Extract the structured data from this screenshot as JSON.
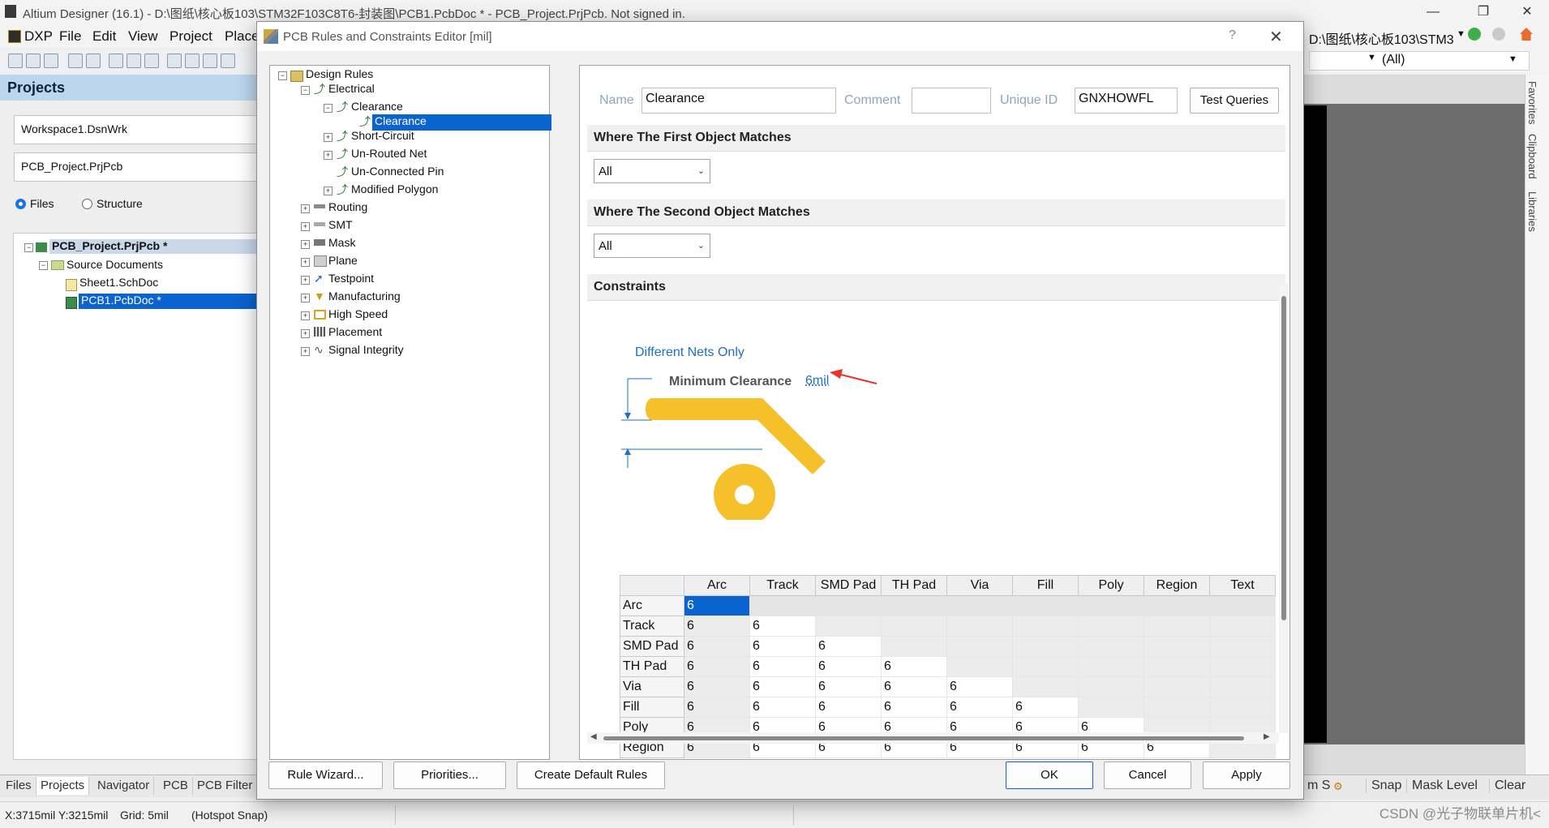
{
  "app": {
    "title": "Altium Designer (16.1) - D:\\图纸\\核心板103\\STM32F103C8T6-封装图\\PCB1.PcbDoc * - PCB_Project.PrjPcb. Not signed in.",
    "menu": [
      "DXP",
      "File",
      "Edit",
      "View",
      "Project",
      "Place"
    ],
    "right_path": "D:\\图纸\\核心板103\\STM3",
    "right_filter": "(All)"
  },
  "projects": {
    "header": "Projects",
    "workspace": "Workspace1.DsnWrk",
    "project": "PCB_Project.PrjPcb",
    "radio_files": "Files",
    "radio_structure": "Structure",
    "tree": {
      "project": "PCB_Project.PrjPcb *",
      "source_docs": "Source Documents",
      "sheet": "Sheet1.SchDoc",
      "pcb": "PCB1.PcbDoc *"
    },
    "bottom_tabs": [
      "Files",
      "Projects",
      "Navigator",
      "PCB",
      "PCB Filter"
    ]
  },
  "right_panel": {
    "side_tabs": [
      "Favorites",
      "Clipboard",
      "Libraries"
    ],
    "bottom": [
      "m S",
      "Snap",
      "Mask Level",
      "Clear"
    ]
  },
  "status": {
    "coords": "X:3715mil Y:3215mil",
    "grid": "Grid: 5mil",
    "snap": "(Hotspot Snap)",
    "watermark": "CSDN @光子物联单片机<"
  },
  "dialog": {
    "title": "PCB Rules and Constraints Editor [mil]",
    "help": "?",
    "tree": {
      "root": "Design Rules",
      "electrical": "Electrical",
      "clearance": "Clearance",
      "clearance_rule": "Clearance",
      "short_circuit": "Short-Circuit",
      "unrouted": "Un-Routed Net",
      "unconnected": "Un-Connected Pin",
      "modified_polygon": "Modified Polygon",
      "routing": "Routing",
      "smt": "SMT",
      "mask": "Mask",
      "plane": "Plane",
      "testpoint": "Testpoint",
      "manufacturing": "Manufacturing",
      "high_speed": "High Speed",
      "placement": "Placement",
      "signal_integrity": "Signal Integrity"
    },
    "name_label": "Name",
    "name_value": "Clearance",
    "comment_label": "Comment",
    "comment_value": "",
    "uid_label": "Unique ID",
    "uid_value": "GNXHOWFL",
    "test_queries": "Test Queries",
    "first_match_title": "Where The First Object Matches",
    "first_match_value": "All",
    "second_match_title": "Where The Second Object Matches",
    "second_match_value": "All",
    "constraints_title": "Constraints",
    "nets_option": "Different Nets Only",
    "min_clearance_label": "Minimum Clearance",
    "min_clearance_value": "6mil",
    "matrix": {
      "columns": [
        "Arc",
        "Track",
        "SMD Pad",
        "TH Pad",
        "Via",
        "Fill",
        "Poly",
        "Region",
        "Text"
      ],
      "rows": [
        {
          "label": "Arc",
          "values": [
            "6"
          ]
        },
        {
          "label": "Track",
          "values": [
            "6",
            "6"
          ]
        },
        {
          "label": "SMD Pad",
          "values": [
            "6",
            "6",
            "6"
          ]
        },
        {
          "label": "TH Pad",
          "values": [
            "6",
            "6",
            "6",
            "6"
          ]
        },
        {
          "label": "Via",
          "values": [
            "6",
            "6",
            "6",
            "6",
            "6"
          ]
        },
        {
          "label": "Fill",
          "values": [
            "6",
            "6",
            "6",
            "6",
            "6",
            "6"
          ]
        },
        {
          "label": "Poly",
          "values": [
            "6",
            "6",
            "6",
            "6",
            "6",
            "6",
            "6"
          ]
        },
        {
          "label": "Region",
          "values": [
            "6",
            "6",
            "6",
            "6",
            "6",
            "6",
            "6",
            "6"
          ]
        }
      ]
    },
    "buttons": {
      "rule_wizard": "Rule Wizard...",
      "priorities": "Priorities...",
      "create_default": "Create Default Rules",
      "ok": "OK",
      "cancel": "Cancel",
      "apply": "Apply"
    },
    "colors": {
      "accent": "#0b63cf",
      "copper": "#f5c02a",
      "arrow": "#e8322b"
    }
  }
}
